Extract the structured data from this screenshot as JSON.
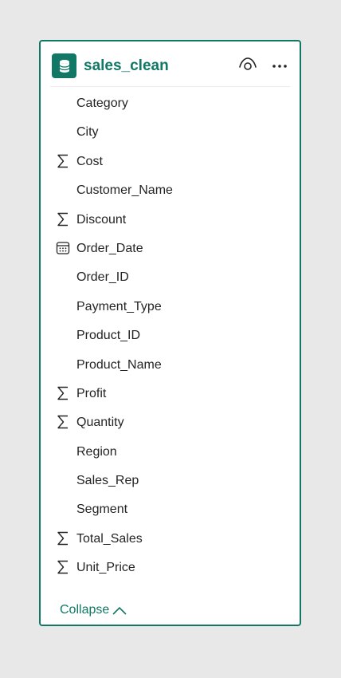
{
  "table": {
    "title": "sales_clean",
    "icon": "database-icon",
    "visibility_icon": "eye-icon",
    "more_icon": "more-options-icon",
    "accent_color": "#117865"
  },
  "fields": [
    {
      "name": "Category",
      "icon": "none"
    },
    {
      "name": "City",
      "icon": "none"
    },
    {
      "name": "Cost",
      "icon": "sigma-icon"
    },
    {
      "name": "Customer_Name",
      "icon": "none"
    },
    {
      "name": "Discount",
      "icon": "sigma-icon"
    },
    {
      "name": "Order_Date",
      "icon": "calendar-icon"
    },
    {
      "name": "Order_ID",
      "icon": "none"
    },
    {
      "name": "Payment_Type",
      "icon": "none"
    },
    {
      "name": "Product_ID",
      "icon": "none"
    },
    {
      "name": "Product_Name",
      "icon": "none"
    },
    {
      "name": "Profit",
      "icon": "sigma-icon"
    },
    {
      "name": "Quantity",
      "icon": "sigma-icon"
    },
    {
      "name": "Region",
      "icon": "none"
    },
    {
      "name": "Sales_Rep",
      "icon": "none"
    },
    {
      "name": "Segment",
      "icon": "none"
    },
    {
      "name": "Total_Sales",
      "icon": "sigma-icon"
    },
    {
      "name": "Unit_Price",
      "icon": "sigma-icon"
    }
  ],
  "footer": {
    "collapse_label": "Collapse",
    "collapse_icon": "chevron-up-icon"
  }
}
